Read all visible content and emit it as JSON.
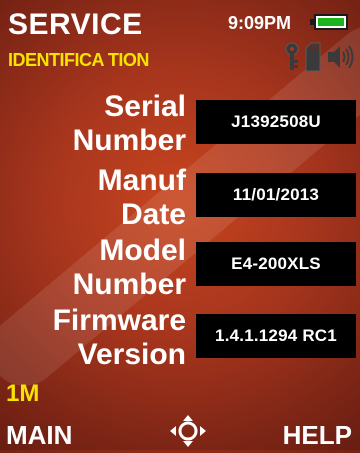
{
  "header": {
    "title": "SERVICE",
    "subtitle": "IDENTIFICA TION",
    "time": "9:09PM",
    "battery_icon": "battery-full-icon",
    "status_icons": [
      "key-icon",
      "sd-card-icon",
      "speaker-icon"
    ]
  },
  "rows": [
    {
      "label_line1": "Serial",
      "label_line2": "Number",
      "value": "J1392508U"
    },
    {
      "label_line1": "Manuf",
      "label_line2": "Date",
      "value": "11/01/2013"
    },
    {
      "label_line1": "Model",
      "label_line2": "Number",
      "value": "E4-200XLS"
    },
    {
      "label_line1": "Firmware",
      "label_line2": "Version",
      "value": "1.4.1.1294 RC1"
    }
  ],
  "footer": {
    "mode_label": "1M",
    "left_softkey": "MAIN",
    "center_icon": "navigation-pad-icon",
    "right_softkey": "HELP"
  },
  "colors": {
    "accent": "#f6e300",
    "background": "#a6351d",
    "value_box": "#000000",
    "battery_fill": "#1db31d"
  }
}
